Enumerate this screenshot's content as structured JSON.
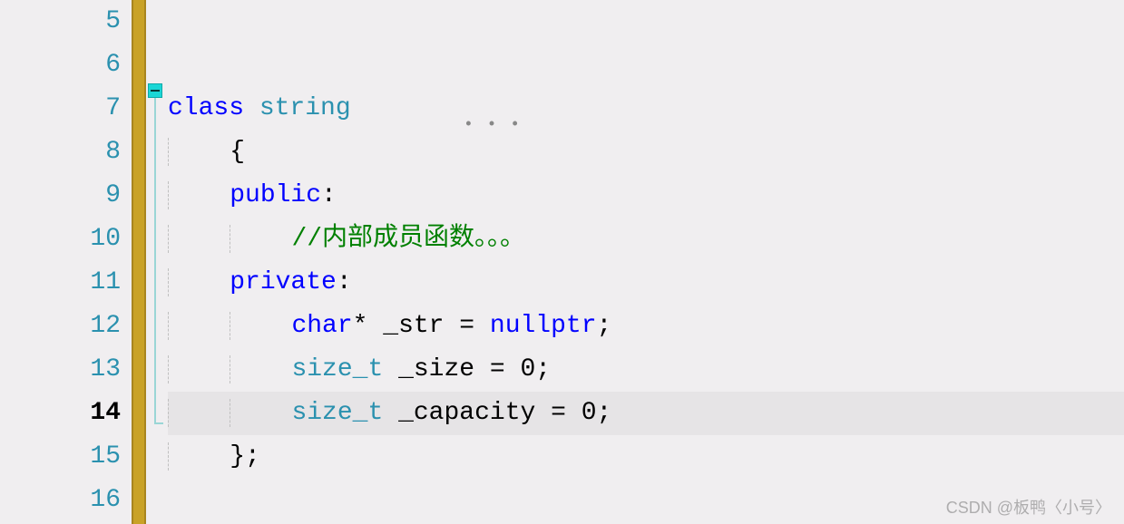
{
  "gutter": {
    "start": 5,
    "end": 16,
    "current": 14
  },
  "code": {
    "lines": [
      {
        "n": 5,
        "indent": 0,
        "segments": []
      },
      {
        "n": 6,
        "indent": 0,
        "segments": []
      },
      {
        "n": 7,
        "indent": 0,
        "segments": [
          {
            "t": "class ",
            "c": "kw"
          },
          {
            "t": "string",
            "c": "type underline-squiggle"
          }
        ]
      },
      {
        "n": 8,
        "indent": 1,
        "segments": [
          {
            "t": "{",
            "c": "text-default"
          }
        ]
      },
      {
        "n": 9,
        "indent": 1,
        "segments": [
          {
            "t": "public",
            "c": "kw"
          },
          {
            "t": ":",
            "c": "text-default"
          }
        ]
      },
      {
        "n": 10,
        "indent": 2,
        "segments": [
          {
            "t": "//内部成员函数。。。",
            "c": "comment"
          }
        ]
      },
      {
        "n": 11,
        "indent": 1,
        "segments": [
          {
            "t": "private",
            "c": "kw"
          },
          {
            "t": ":",
            "c": "text-default"
          }
        ]
      },
      {
        "n": 12,
        "indent": 2,
        "segments": [
          {
            "t": "char",
            "c": "kw"
          },
          {
            "t": "* _str = ",
            "c": "text-default"
          },
          {
            "t": "nullptr",
            "c": "kw"
          },
          {
            "t": ";",
            "c": "text-default"
          }
        ]
      },
      {
        "n": 13,
        "indent": 2,
        "segments": [
          {
            "t": "size_t",
            "c": "type"
          },
          {
            "t": " _size = 0;",
            "c": "text-default"
          }
        ]
      },
      {
        "n": 14,
        "indent": 2,
        "segments": [
          {
            "t": "size_t",
            "c": "type"
          },
          {
            "t": " _capacity = 0;",
            "c": "text-default"
          }
        ],
        "highlight": true
      },
      {
        "n": 15,
        "indent": 1,
        "segments": [
          {
            "t": "};",
            "c": "text-default"
          }
        ]
      },
      {
        "n": 16,
        "indent": 0,
        "segments": []
      }
    ]
  },
  "watermark": "CSDN @板鸭〈小号〉",
  "squiggle_dots": "• • •"
}
